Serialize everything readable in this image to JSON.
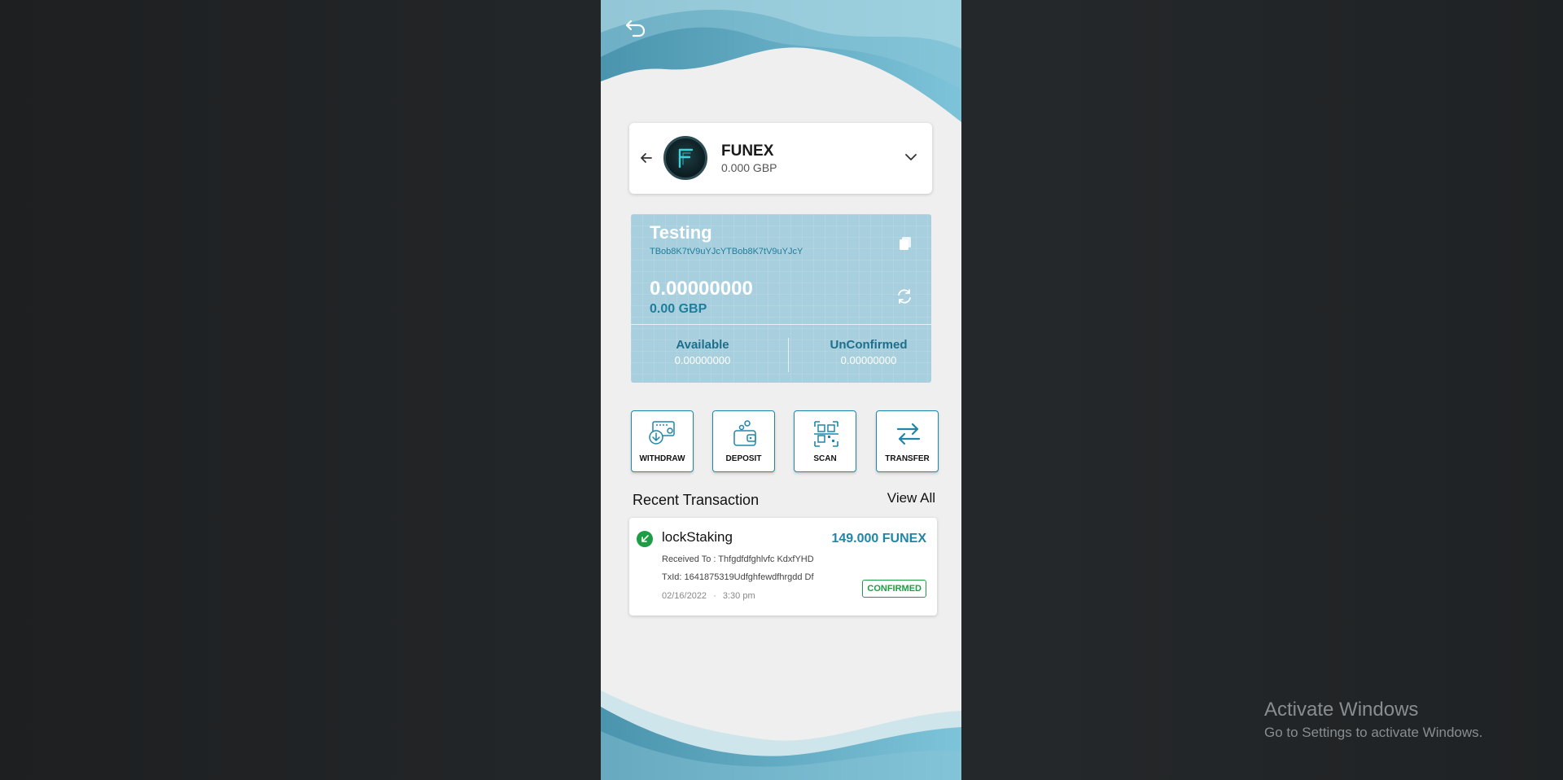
{
  "coin": {
    "name": "FUNEX",
    "fiat_value": "0.000 GBP"
  },
  "wallet": {
    "name": "Testing",
    "address": "TBob8K7tV9uYJcYTBob8K7tV9uYJcY",
    "balance": "0.00000000",
    "balance_fiat": "0.00 GBP",
    "available_label": "Available",
    "available_value": "0.00000000",
    "unconfirmed_label": "UnConfirmed",
    "unconfirmed_value": "0.00000000"
  },
  "actions": {
    "withdraw": "WITHDRAW",
    "deposit": "DEPOSIT",
    "scan": "SCAN",
    "transfer": "TRANSFER"
  },
  "recent": {
    "title": "Recent Transaction",
    "view_all": "View All"
  },
  "transaction": {
    "type": "lockStaking",
    "amount": "149.000 FUNEX",
    "received_to": "Received To : Thfgdfdfghlvfc KdxfYHD",
    "txid": "TxId: 1641875319Udfghfewdfhrgdd Df",
    "date": "02/16/2022",
    "time": "3:30 pm",
    "date_sep": "·",
    "status": "CONFIRMED"
  },
  "watermark": {
    "title": "Activate Windows",
    "subtitle": "Go to Settings to activate Windows."
  },
  "colors": {
    "accent": "#1f86a8",
    "wallet_card": "#a8cfdd",
    "success": "#1f9c45"
  }
}
